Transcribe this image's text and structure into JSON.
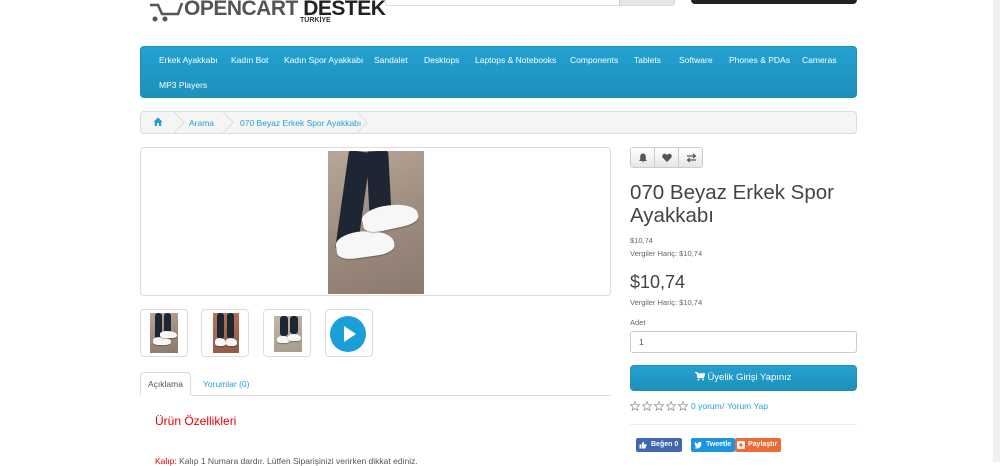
{
  "header": {
    "logo_main": "OPENCART",
    "logo_bold": "DESTEK",
    "logo_sub": "TÜRKİYE"
  },
  "menu": {
    "items": [
      {
        "label": "Erkek Ayakkabı"
      },
      {
        "label": "Kadın Bot"
      },
      {
        "label": "Kadın Spor Ayakkabı"
      },
      {
        "label": "Sandalet"
      },
      {
        "label": "Desktops"
      },
      {
        "label": "Laptops & Notebooks"
      },
      {
        "label": "Components"
      },
      {
        "label": "Tablets"
      },
      {
        "label": "Software"
      },
      {
        "label": "Phones & PDAs"
      },
      {
        "label": "Cameras"
      },
      {
        "label": "MP3 Players"
      }
    ]
  },
  "breadcrumb": {
    "home_icon": "home-icon",
    "items": [
      {
        "label": "Arama"
      },
      {
        "label": "070 Beyaz Erkek Spor Ayakkabı"
      }
    ]
  },
  "tabs": {
    "description": "Açıklama",
    "reviews": "Yorumlar (0)"
  },
  "description": {
    "features_title": "Ürün Özellikleri",
    "first_label": "Kalıp:",
    "first_text": " Kalıp 1 Numara dardır. Lütfen Siparişinizi verirken dikkat ediniz."
  },
  "product": {
    "title": "070 Beyaz Erkek Spor Ayakkabı",
    "price_small": "$10,74",
    "ex_tax_small": "Vergiler Hariç: $10,74",
    "price_big": "$10,74",
    "ex_tax_big": "Vergiler Hariç: $10,74",
    "qty_label": "Adet",
    "qty_value": "1",
    "login_button": "Üyelik Girişi Yapınız",
    "rating": 0,
    "reviews_link": "0 yorum",
    "review_sep": "/",
    "write_review": "Yorum Yap"
  },
  "share": {
    "facebook": "Beğen 0",
    "twitter": "Tweetle",
    "other": "Paylaştır"
  },
  "colors": {
    "accent": "#23a1d1",
    "menu_bg": "#229ac8",
    "red": "#ee0000",
    "facebook": "#4267b2",
    "twitter": "#1b95e0",
    "share_other": "#f06a35"
  }
}
